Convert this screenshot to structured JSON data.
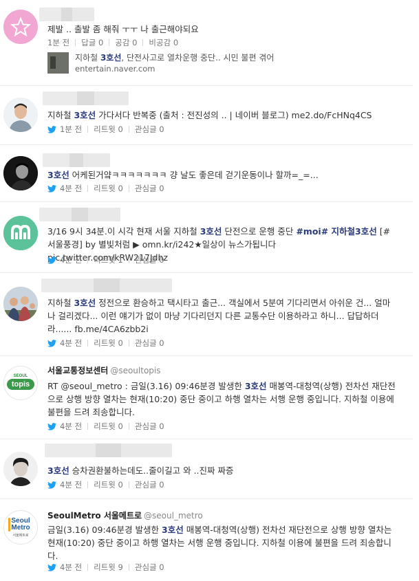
{
  "tweets": [
    {
      "avatar": "pink-star-avatar",
      "text": [
        "제발 .. 출발 좀 해줘 ㅜㅜ 나 출근해야되요"
      ],
      "time": "1분 전",
      "reply": "답글 0",
      "like": "공감 0",
      "dislike": "비공감 0",
      "preview_title_pre": "지하철 ",
      "preview_title_hl": "3호선",
      "preview_title_post": ", 단전사고로 열차운행 중단.. 시민 불편 겪어",
      "preview_url": "entertain.naver.com"
    },
    {
      "avatar": "man-portrait-avatar",
      "pre": "지하철 ",
      "hl": "3호선",
      "post": " 가다서다 반복중 (출처 : 전진성의 .. | 네이버 블로그) me2.do/FcHNq4CS",
      "time": "1분 전",
      "retweet": "리트윗 0",
      "related": "관심글 0"
    },
    {
      "avatar": "dark-portrait-avatar",
      "pre": "",
      "hl": "3호선",
      "post": " 어케된거얔ㅋㅋㅋㅋㅋㅋㅋ 걍 날도 좋은데 걷기운동이나 할까=_=...",
      "time": "4분 전",
      "retweet": "리트윗 0",
      "related": "관심글 0"
    },
    {
      "avatar": "green-logo-avatar",
      "line1_pre": "3/16 9시 34분.이 시각 현재 서울 지하철 ",
      "line1_hl": "3호선",
      "line1_post": " 단전으로 운행 중단 ",
      "line1_tag": "#moi# 지하철",
      "line1_tag_hl": "3호선",
      "line1_end": " [#",
      "line2": "서울풍경] by 별빛처럼 ▶ omn.kr/i242★일상이 뉴스가됩니다 pic.twitter.com/kRW217Jdhz",
      "time": "4분 전",
      "retweet": "리트윗 1",
      "related": "관심글 0"
    },
    {
      "avatar": "group-photo-avatar",
      "pre": "지하철 ",
      "hl": "3호선",
      "post": " 정전으로 환승하고 택시타고 출근... 객실에서 5분여 기다리면서 아쉬운 건... 얼마나 걸리겠다... 이런 얘기가 없이 마냥 기다리던지 다른 교통수단 이용하라고 하니... 답답하더라...... fb.me/4CA6zbb2i",
      "time": "4분 전",
      "retweet": "리트윗 0",
      "related": "관심글 0"
    },
    {
      "avatar": "topis-logo-avatar",
      "logo_small": "SEOUL",
      "logo_big": "topis",
      "author": "서울교통정보센터",
      "handle": "@seoultopis",
      "pre": "RT @seoul_metro : 금일(3.16) 09:46분경 발생한 ",
      "hl": "3호선",
      "post": " 매봉역-대청역(상행) 전차선 재단전으로 상행 방향 열차는 현재(10:20) 중단 중이고 하행 열차는 서행 운행 중입니다. 지하철 이용에 불편을 드려 죄송합니다.",
      "time": "4분 전",
      "retweet": "리트윗 0",
      "related": "관심글 0"
    },
    {
      "avatar": "boy-portrait-avatar",
      "pre": "",
      "hl": "3호선",
      "post": " 승차권환불하는데도..줄이길고 와 ..진짜 짜증",
      "time": "4분 전",
      "retweet": "리트윗 0",
      "related": "관심글 0"
    },
    {
      "avatar": "seoulmetro-logo-avatar",
      "logo_l1": "Seoul",
      "logo_l2": "Metro",
      "logo_l3": "서울메트로",
      "author": "SeoulMetro 서울메트로",
      "handle": "@seoul_metro",
      "pre": "금일(3.16) 09:46분경 발생한 ",
      "hl": "3호선",
      "post": " 매봉역-대청역(상행) 전차선 재단전으로 상행 방향 열차는 현재(10:20) 중단 중이고 하행 열차는 서행 운행 중입니다. 지하철 이용에 불편을 드려 죄송합니다.",
      "time": "4분 전",
      "retweet": "리트윗 9",
      "related": "관심글 0"
    }
  ],
  "colors": {
    "highlight": "#2a3a7a",
    "twitter": "#1da1f2",
    "meta_text": "#777777",
    "divider": "#ececec"
  }
}
